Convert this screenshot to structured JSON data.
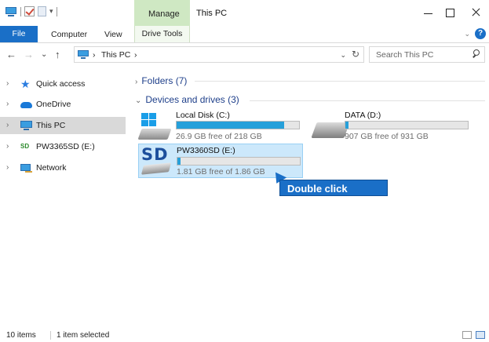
{
  "window": {
    "title": "This PC",
    "contextual_tab": "Manage"
  },
  "ribbon": {
    "file": "File",
    "computer": "Computer",
    "view": "View",
    "drive_tools": "Drive Tools",
    "help": "?"
  },
  "nav": {
    "back": "←",
    "forward": "→",
    "recent": "⌄",
    "up": "↑"
  },
  "address": {
    "root": "This PC",
    "sep": "›",
    "dropdown": "⌄",
    "refresh": "↻"
  },
  "search": {
    "placeholder": "Search This PC"
  },
  "sidebar": {
    "items": [
      {
        "label": "Quick access",
        "icon": "star-icon"
      },
      {
        "label": "OneDrive",
        "icon": "cloud-icon"
      },
      {
        "label": "This PC",
        "icon": "computer-icon",
        "selected": true
      },
      {
        "label": "PW3365SD (E:)",
        "icon": "sd-card-icon"
      },
      {
        "label": "Network",
        "icon": "network-icon"
      }
    ],
    "arrow": "›"
  },
  "content": {
    "folders_header": "Folders (7)",
    "devices_header": "Devices and drives (3)",
    "drives": [
      {
        "name": "Local Disk (C:)",
        "free_text": "26.9 GB free of 218 GB",
        "used_fraction": 0.877,
        "icon": "windows-disk-icon"
      },
      {
        "name": "DATA (D:)",
        "free_text": "907 GB free of 931 GB",
        "used_fraction": 0.026,
        "icon": "hard-disk-icon"
      },
      {
        "name": "PW3360SD (E:)",
        "free_text": "1.81 GB free of 1.86 GB",
        "used_fraction": 0.027,
        "icon": "sd-card-icon",
        "selected": true
      }
    ],
    "sd_label": "SD"
  },
  "callout": {
    "text": "Double click"
  },
  "status": {
    "items": "10 items",
    "selected": "1 item selected"
  },
  "colors": {
    "accent": "#1a6fc7",
    "manage_tab": "#cfe8c3",
    "bar_fill": "#26a0da",
    "selection": "#cce8fb"
  }
}
